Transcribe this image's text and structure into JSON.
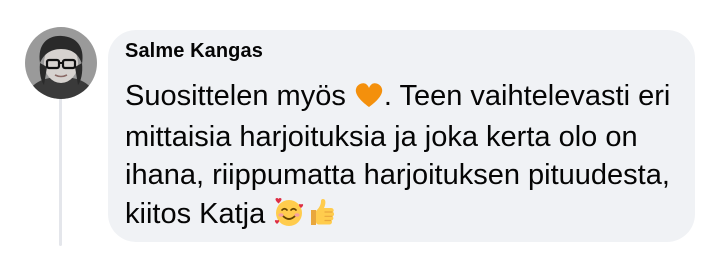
{
  "comment": {
    "author": "Salme Kangas",
    "lines": [
      {
        "before": "Suosittelen myös ",
        "after": ". Teen vaihtelevasti eri"
      },
      "mittaisia harjoituksia ja joka kerta olo on",
      "ihana, riippumatta harjoituksen pituudesta,",
      "kiitos Katja "
    ],
    "emojis": [
      "orange-heart-icon",
      "smiling-face-with-hearts-icon",
      "thumbs-up-icon"
    ]
  },
  "colors": {
    "bubble": "#f0f2f5",
    "text": "#050505",
    "thread_line": "#e4e6eb"
  }
}
